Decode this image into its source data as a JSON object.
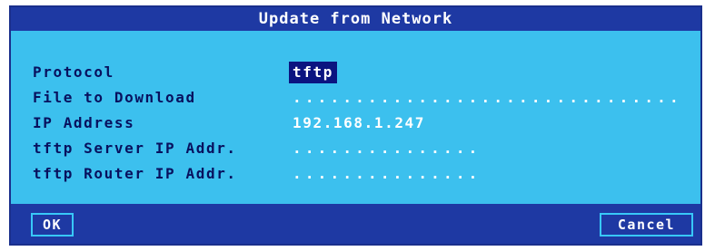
{
  "dialog": {
    "title": "Update from Network",
    "fields": [
      {
        "label": "Protocol",
        "value": "tftp"
      },
      {
        "label": "File to Download",
        "value": "..............................."
      },
      {
        "label": "IP Address",
        "value": "192.168.1.247"
      },
      {
        "label": "tftp Server IP Addr.",
        "value": "..............."
      },
      {
        "label": "tftp Router IP Addr.",
        "value": "..............."
      }
    ],
    "buttons": {
      "ok": "OK",
      "cancel": "Cancel"
    }
  },
  "colors": {
    "background": "#3cc0ee",
    "titlebar": "#1e39a3",
    "label_text": "#08115e",
    "value_text": "#ffffff",
    "selected_background": "#0b1480"
  }
}
